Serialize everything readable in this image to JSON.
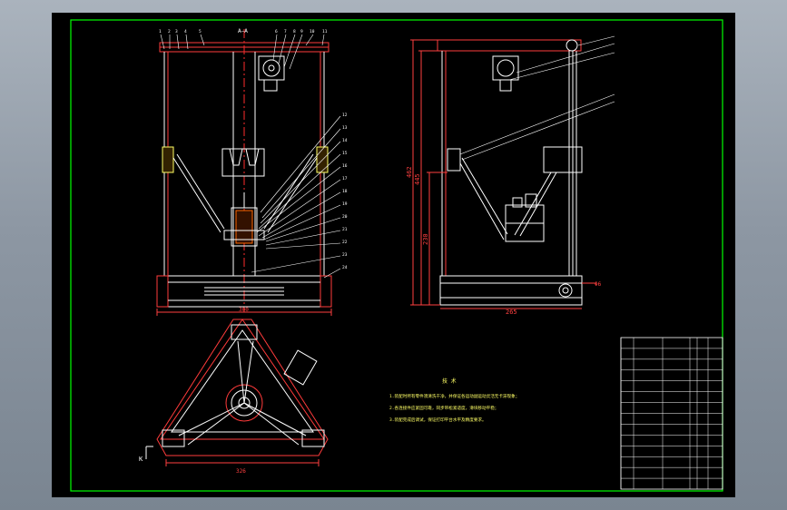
{
  "drawing": {
    "section_mark": "A—A",
    "view_marker": "K",
    "front_view": {
      "dim_bottom_width": "300",
      "callouts": [
        "1",
        "2",
        "3",
        "4",
        "5",
        "6",
        "7",
        "8",
        "9",
        "10",
        "11",
        "12",
        "13",
        "14",
        "15",
        "16",
        "17",
        "18",
        "19",
        "20",
        "21",
        "22",
        "23",
        "24",
        "25",
        "26",
        "27"
      ]
    },
    "side_view": {
      "dim_height_total": "462",
      "dim_height_inner": "445",
      "dim_height_lower": "230",
      "dim_bottom_width": "265",
      "dim_diameter": "Φ6"
    },
    "top_view": {
      "dim_bottom_width": "326"
    },
    "notes": {
      "title": "技  术",
      "lines": [
        "1.装配时所有零件须清洗干净，并保证各运动副运动灵活无卡滞现象；",
        "2.各连接件应紧固可靠，同步带松紧适度，滑块移动平稳；",
        "3.装配完成后调试，保证打印平台水平及精度要求。"
      ]
    },
    "title_block": {
      "rows": 14,
      "cols": 5
    }
  },
  "colors": {
    "background": "#000000",
    "frame": "#00ff00",
    "geometry": "#ffffff",
    "parts": "#ff3b3b",
    "centerline": "#ff2b2b",
    "leader": "#ffff66",
    "notes": "#ffff66",
    "dims": "#ff4040"
  }
}
